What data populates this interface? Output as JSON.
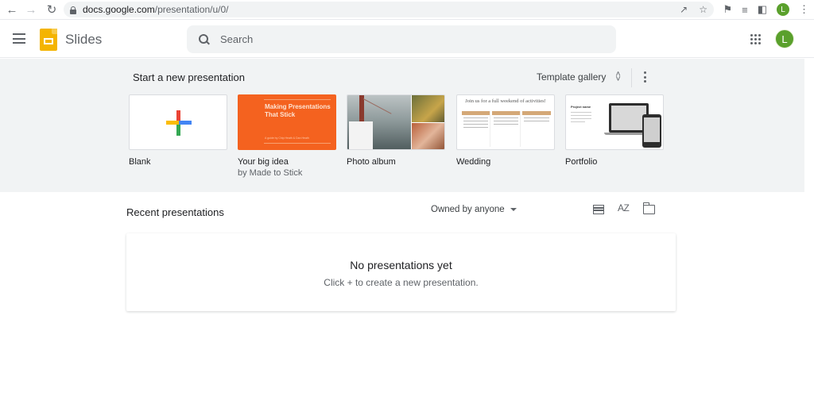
{
  "browser": {
    "url_host": "docs.google.com",
    "url_path": "/presentation/u/0/",
    "profile_initial": "L",
    "icons": [
      "back-icon",
      "forward-icon",
      "reload-icon",
      "lock-icon",
      "share-icon",
      "star-icon",
      "extensions-icon",
      "media-icon",
      "side-panel-icon",
      "profile-avatar",
      "chrome-menu-icon"
    ]
  },
  "header": {
    "app_name": "Slides",
    "search_placeholder": "Search",
    "account_initial": "L",
    "brand_color": "#f4b400",
    "avatar_color": "#5aa02c"
  },
  "templates": {
    "title": "Start a new presentation",
    "gallery_label": "Template gallery",
    "items": [
      {
        "label": "Blank",
        "sub": ""
      },
      {
        "label": "Your big idea",
        "sub": "by Made to Stick",
        "thumb_title": "Making Presentations That Stick",
        "thumb_sub": "A guide by Chip Heath & Dan Heath"
      },
      {
        "label": "Photo album",
        "sub": ""
      },
      {
        "label": "Wedding",
        "sub": "",
        "thumb_title": "Join us for a full weekend of activities!"
      },
      {
        "label": "Portfolio",
        "sub": "",
        "thumb_title": "Project name"
      }
    ]
  },
  "recent": {
    "title": "Recent presentations",
    "owner_filter": "Owned by anyone",
    "sort_label": "AZ",
    "empty_title": "No presentations yet",
    "empty_sub": "Click + to create a new presentation."
  }
}
